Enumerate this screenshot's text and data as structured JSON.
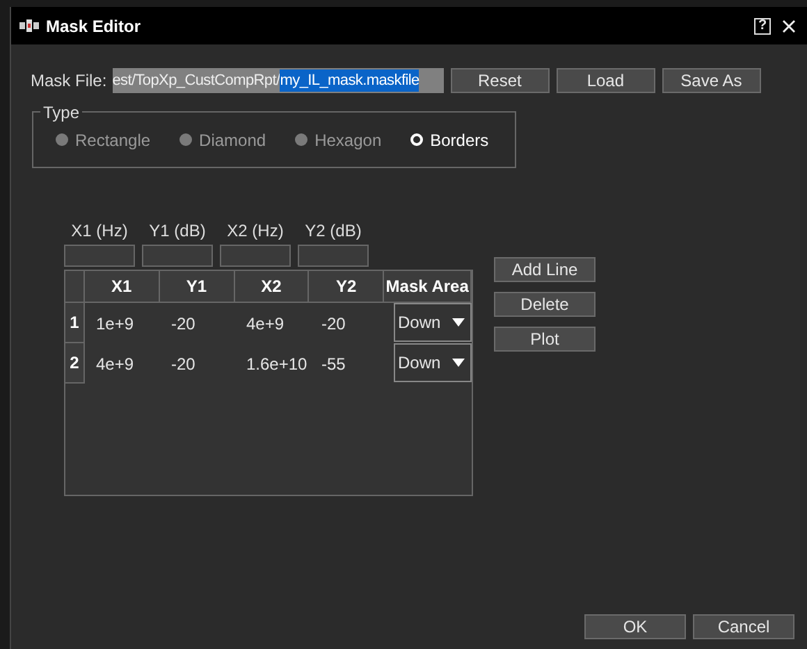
{
  "window": {
    "title": "Mask Editor",
    "help_glyph": "?"
  },
  "mask_file": {
    "label": "Mask File:",
    "value_prefix": "est/TopXp_CustCompRpt/",
    "value_selected": "my_IL_mask.maskfile"
  },
  "file_buttons": [
    "Reset",
    "Load",
    "Save As"
  ],
  "type_group": {
    "title": "Type",
    "options": [
      {
        "label": "Rectangle",
        "selected": false
      },
      {
        "label": "Diamond",
        "selected": false
      },
      {
        "label": "Hexagon",
        "selected": false
      },
      {
        "label": "Borders",
        "selected": true
      }
    ]
  },
  "inputs": [
    {
      "label": "X1 (Hz)"
    },
    {
      "label": "Y1 (dB)"
    },
    {
      "label": "X2 (Hz)"
    },
    {
      "label": "Y2 (dB)"
    }
  ],
  "table": {
    "columns": [
      "X1",
      "Y1",
      "X2",
      "Y2",
      "Mask Area"
    ],
    "rows": [
      {
        "number": "1",
        "cells": [
          "1e+9",
          "-20",
          "4e+9",
          "-20"
        ],
        "mask_area": "Down"
      },
      {
        "number": "2",
        "cells": [
          "4e+9",
          "-20",
          "1.6e+10",
          "-55"
        ],
        "mask_area": "Down"
      }
    ]
  },
  "side_buttons": [
    "Add Line",
    "Delete",
    "Plot"
  ],
  "dialog_buttons": [
    "OK",
    "Cancel"
  ]
}
